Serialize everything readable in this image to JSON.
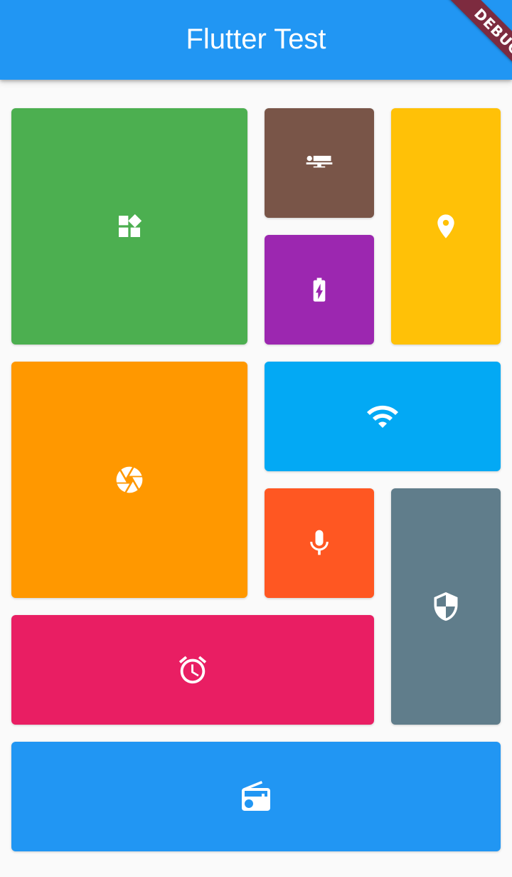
{
  "app_bar": {
    "title": "Flutter Test",
    "debug_banner": "DEBUG",
    "color": "#2196F3"
  },
  "tiles": [
    {
      "name": "widgets",
      "icon": "widgets-icon",
      "color": "#4CAF50"
    },
    {
      "name": "hotel",
      "icon": "hotel-icon",
      "color": "#795548"
    },
    {
      "name": "location",
      "icon": "location-pin-icon",
      "color": "#FFC107"
    },
    {
      "name": "battery",
      "icon": "battery-charging-icon",
      "color": "#9C27B0"
    },
    {
      "name": "camera",
      "icon": "camera-aperture-icon",
      "color": "#FF9800"
    },
    {
      "name": "wifi",
      "icon": "wifi-icon",
      "color": "#03A9F4"
    },
    {
      "name": "mic",
      "icon": "mic-icon",
      "color": "#FF5722"
    },
    {
      "name": "security",
      "icon": "security-shield-icon",
      "color": "#607D8B"
    },
    {
      "name": "alarm",
      "icon": "alarm-icon",
      "color": "#E91E63"
    },
    {
      "name": "radio",
      "icon": "radio-icon",
      "color": "#2196F3"
    }
  ]
}
